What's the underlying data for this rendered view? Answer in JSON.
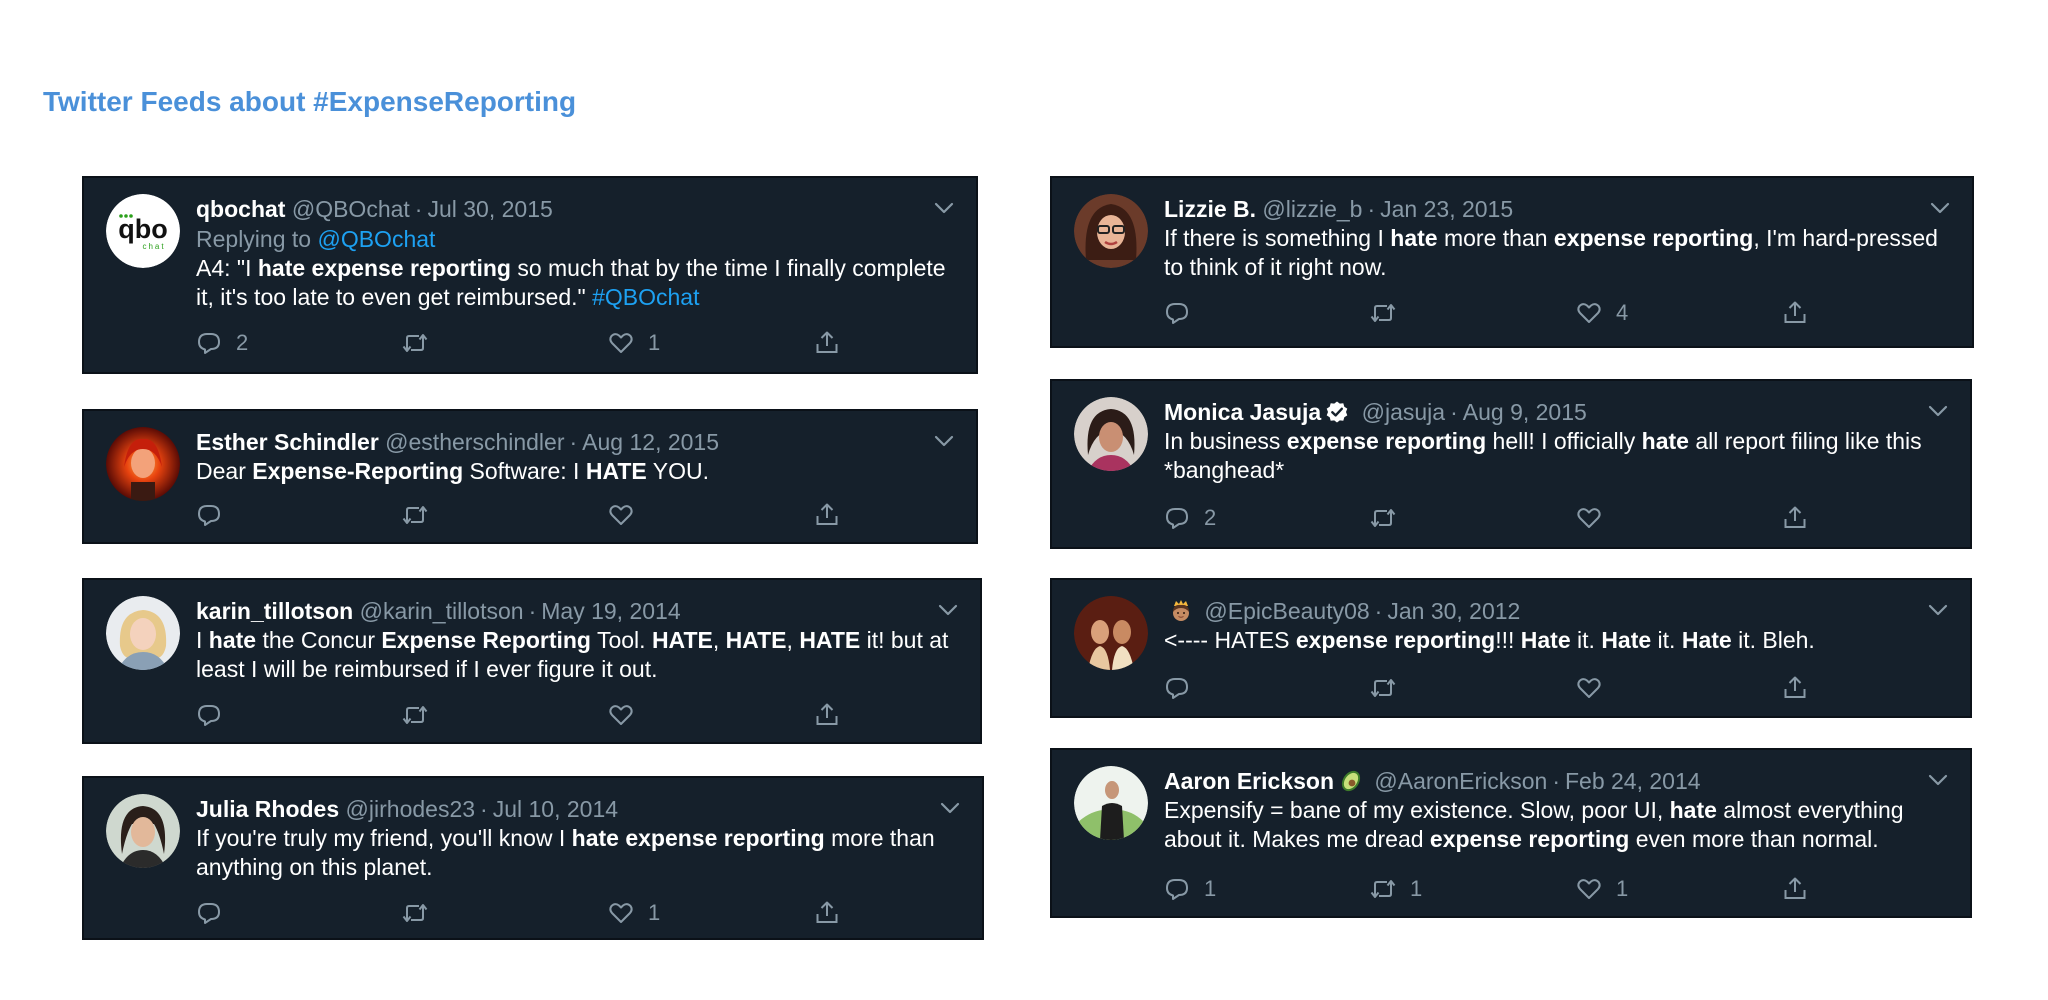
{
  "page": {
    "title": "Twitter Feeds about #ExpenseReporting"
  },
  "colors": {
    "title": "#4a90d9",
    "card_bg": "#15202b",
    "muted": "#8899a6",
    "link": "#1da1f2"
  },
  "icons": {
    "reply": "reply-icon",
    "retweet": "retweet-icon",
    "like": "heart-icon",
    "share": "share-icon",
    "menu": "chevron-down-icon",
    "verified": "verified-badge-icon"
  },
  "tweets": [
    {
      "name": "qbochat",
      "handle": "@QBOchat",
      "sep": "·",
      "date": "Jul 30, 2015",
      "reply_prefix": "Replying to",
      "reply_to": "@QBOchat",
      "avatar_text": "qbo",
      "avatar_subtext": "chat",
      "segments": [
        {
          "t": "A4: \"I "
        },
        {
          "t": "hate expense reporting",
          "b": true
        },
        {
          "t": " so much that by the time I finally complete it, it's too late to even get reimbursed.\" "
        },
        {
          "t": "#QBOchat",
          "l": true
        }
      ],
      "counts": {
        "reply": "2",
        "retweet": "",
        "like": "1"
      }
    },
    {
      "name": "Esther Schindler",
      "handle": "@estherschindler",
      "sep": "·",
      "date": "Aug 12, 2015",
      "segments": [
        {
          "t": "Dear "
        },
        {
          "t": "Expense-Reporting",
          "b": true
        },
        {
          "t": " Software: I "
        },
        {
          "t": "HATE",
          "b": true
        },
        {
          "t": " YOU."
        }
      ],
      "counts": {
        "reply": "",
        "retweet": "",
        "like": ""
      }
    },
    {
      "name": "karin_tillotson",
      "handle": "@karin_tillotson",
      "sep": "·",
      "date": "May 19, 2014",
      "segments": [
        {
          "t": "I "
        },
        {
          "t": "hate",
          "b": true
        },
        {
          "t": " the Concur "
        },
        {
          "t": "Expense Reporting",
          "b": true
        },
        {
          "t": " Tool. "
        },
        {
          "t": "HATE",
          "b": true
        },
        {
          "t": ", "
        },
        {
          "t": "HATE",
          "b": true
        },
        {
          "t": ", "
        },
        {
          "t": "HATE",
          "b": true
        },
        {
          "t": " it!  but at least I will be reimbursed if I ever figure it out."
        }
      ],
      "counts": {
        "reply": "",
        "retweet": "",
        "like": ""
      }
    },
    {
      "name": "Julia Rhodes",
      "handle": "@jirhodes23",
      "sep": "·",
      "date": "Jul 10, 2014",
      "segments": [
        {
          "t": "If you're truly my friend, you'll know I "
        },
        {
          "t": "hate expense reporting",
          "b": true
        },
        {
          "t": " more than anything on this planet."
        }
      ],
      "counts": {
        "reply": "",
        "retweet": "",
        "like": "1"
      }
    },
    {
      "name": "Lizzie B.",
      "handle": "@lizzie_b",
      "sep": "·",
      "date": "Jan 23, 2015",
      "segments": [
        {
          "t": "If there is something I "
        },
        {
          "t": "hate",
          "b": true
        },
        {
          "t": " more than "
        },
        {
          "t": "expense reporting",
          "b": true
        },
        {
          "t": ", I'm hard-pressed to think of it right now."
        }
      ],
      "counts": {
        "reply": "",
        "retweet": "",
        "like": "4"
      }
    },
    {
      "name": "Monica Jasuja",
      "verified": true,
      "handle": "@jasuja",
      "sep": "·",
      "date": "Aug 9, 2015",
      "segments": [
        {
          "t": "In business "
        },
        {
          "t": "expense reporting",
          "b": true
        },
        {
          "t": " hell! I officially "
        },
        {
          "t": "hate",
          "b": true
        },
        {
          "t": " all report filing like this *banghead*"
        }
      ],
      "counts": {
        "reply": "2",
        "retweet": "",
        "like": ""
      }
    },
    {
      "name": "",
      "name_emoji": "princess-emoji",
      "handle": "@EpicBeauty08",
      "sep": "·",
      "date": "Jan 30, 2012",
      "segments": [
        {
          "t": "<---- HATES "
        },
        {
          "t": "expense reporting",
          "b": true
        },
        {
          "t": "!!! "
        },
        {
          "t": "Hate",
          "b": true
        },
        {
          "t": " it. "
        },
        {
          "t": "Hate",
          "b": true
        },
        {
          "t": " it. "
        },
        {
          "t": "Hate",
          "b": true
        },
        {
          "t": " it. Bleh."
        }
      ],
      "counts": {
        "reply": "",
        "retweet": "",
        "like": ""
      }
    },
    {
      "name": "Aaron Erickson",
      "name_emoji": "avocado-emoji",
      "handle": "@AaronErickson",
      "sep": "·",
      "date": "Feb 24, 2014",
      "segments": [
        {
          "t": "Expensify = bane of my existence. Slow, poor UI, "
        },
        {
          "t": "hate",
          "b": true
        },
        {
          "t": " almost everything about it. Makes me dread "
        },
        {
          "t": "expense reporting",
          "b": true
        },
        {
          "t": " even more than normal."
        }
      ],
      "counts": {
        "reply": "1",
        "retweet": "1",
        "like": "1"
      }
    }
  ]
}
